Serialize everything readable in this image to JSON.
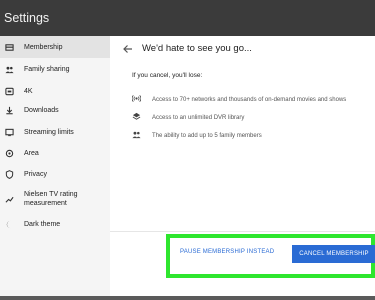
{
  "header": {
    "title": "Settings"
  },
  "sidebar": {
    "items": [
      {
        "label": "Membership",
        "icon": "membership-icon"
      },
      {
        "label": "Family sharing",
        "icon": "family-icon"
      },
      {
        "label": "4K",
        "icon": "4k-icon"
      },
      {
        "label": "Downloads",
        "icon": "download-icon"
      },
      {
        "label": "Streaming limits",
        "icon": "streaming-icon"
      },
      {
        "label": "Area",
        "icon": "location-icon"
      },
      {
        "label": "Privacy",
        "icon": "shield-icon"
      },
      {
        "label": "Nielsen TV rating measurement",
        "icon": "chart-icon"
      },
      {
        "label": "Dark theme",
        "icon": "moon-icon"
      }
    ]
  },
  "content": {
    "title": "We'd hate to see you go...",
    "intro": "If you cancel, you'll lose:",
    "features": [
      {
        "text": "Access to 70+ networks and thousands of on-demand movies and shows",
        "icon": "broadcast-icon"
      },
      {
        "text": "Access to an unlimited DVR library",
        "icon": "layers-icon"
      },
      {
        "text": "The ability to add up to 5 family members",
        "icon": "people-icon"
      }
    ]
  },
  "actions": {
    "pause_label": "PAUSE MEMBERSHIP INSTEAD",
    "cancel_label": "CANCEL MEMBERSHIP"
  },
  "colors": {
    "accent": "#2a6bd4",
    "highlight_frame": "#2ee62e",
    "header_bg": "#3b3b3b"
  }
}
